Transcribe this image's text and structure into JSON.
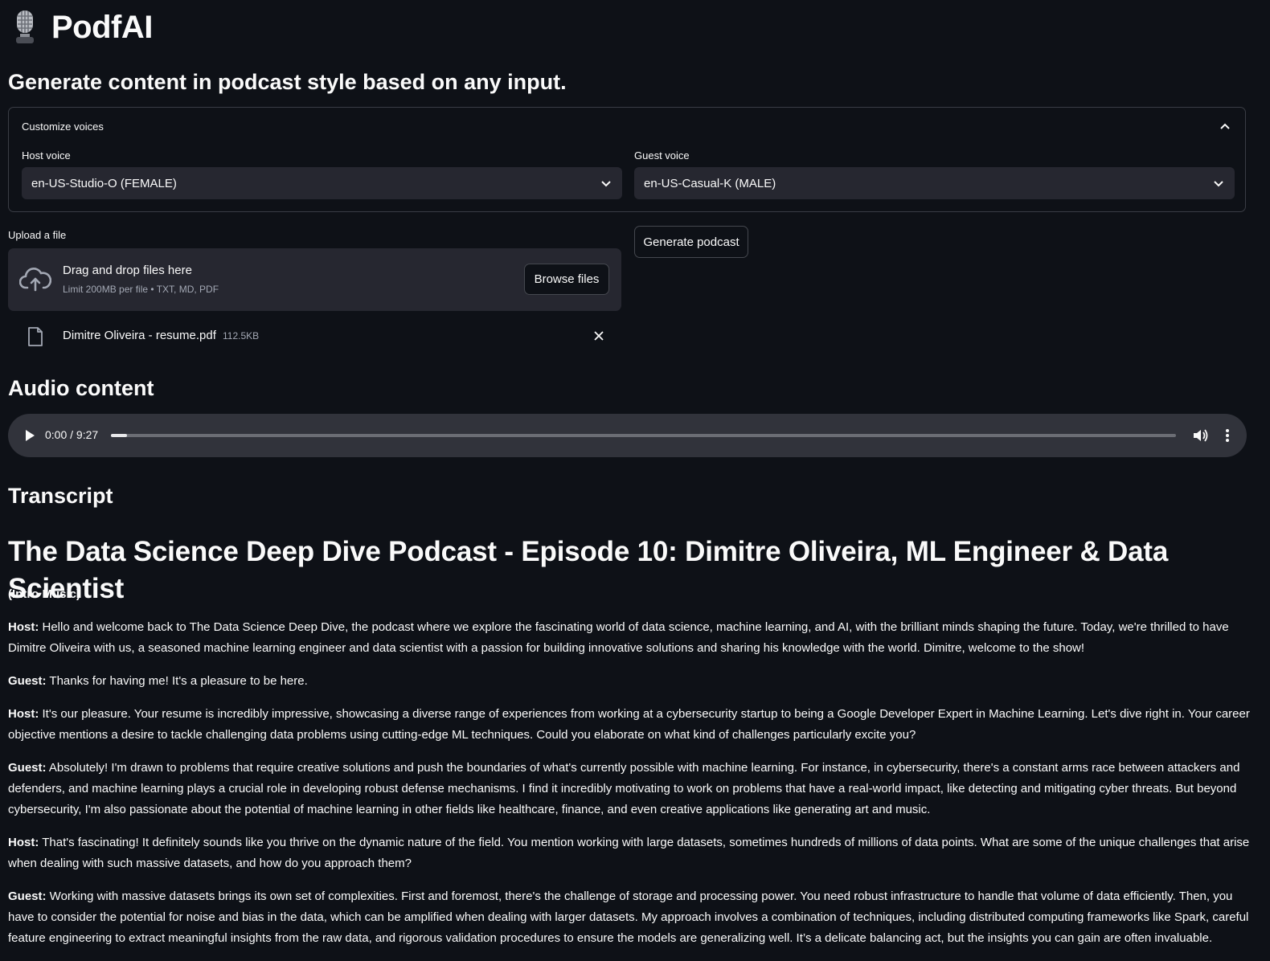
{
  "app": {
    "title": "PodfAI",
    "subtitle": "Generate content in podcast style based on any input."
  },
  "voices": {
    "expander_label": "Customize voices",
    "host_label": "Host voice",
    "host_value": "en-US-Studio-O (FEMALE)",
    "guest_label": "Guest voice",
    "guest_value": "en-US-Casual-K (MALE)"
  },
  "upload": {
    "label": "Upload a file",
    "drop_title": "Drag and drop files here",
    "drop_limit": "Limit 200MB per file • TXT, MD, PDF",
    "browse_label": "Browse files",
    "file_name": "Dimitre Oliveira - resume.pdf",
    "file_size": "112.5KB"
  },
  "generate_label": "Generate podcast",
  "audio": {
    "heading": "Audio content",
    "time": "0:00 / 9:27",
    "progress": 0.0
  },
  "transcript": {
    "heading": "Transcript",
    "episode_title": "The Data Science Deep Dive Podcast - Episode 10: Dimitre Oliveira, ML Engineer & Data Scientist",
    "intro": "(Intro Music)",
    "lines": [
      {
        "speaker": "Host:",
        "text": " Hello and welcome back to The Data Science Deep Dive, the podcast where we explore the fascinating world of data science, machine learning, and AI, with the brilliant minds shaping the future. Today, we're thrilled to have Dimitre Oliveira with us, a seasoned machine learning engineer and data scientist with a passion for building innovative solutions and sharing his knowledge with the world. Dimitre, welcome to the show!"
      },
      {
        "speaker": "Guest:",
        "text": " Thanks for having me! It's a pleasure to be here."
      },
      {
        "speaker": "Host:",
        "text": " It's our pleasure. Your resume is incredibly impressive, showcasing a diverse range of experiences from working at a cybersecurity startup to being a Google Developer Expert in Machine Learning. Let's dive right in. Your career objective mentions a desire to tackle challenging data problems using cutting-edge ML techniques. Could you elaborate on what kind of challenges particularly excite you?"
      },
      {
        "speaker": "Guest:",
        "text": " Absolutely! I'm drawn to problems that require creative solutions and push the boundaries of what's currently possible with machine learning. For instance, in cybersecurity, there's a constant arms race between attackers and defenders, and machine learning plays a crucial role in developing robust defense mechanisms. I find it incredibly motivating to work on problems that have a real-world impact, like detecting and mitigating cyber threats. But beyond cybersecurity, I'm also passionate about the potential of machine learning in other fields like healthcare, finance, and even creative applications like generating art and music."
      },
      {
        "speaker": "Host:",
        "text": " That's fascinating! It definitely sounds like you thrive on the dynamic nature of the field. You mention working with large datasets, sometimes hundreds of millions of data points. What are some of the unique challenges that arise when dealing with such massive datasets, and how do you approach them?"
      },
      {
        "speaker": "Guest:",
        "text": " Working with massive datasets brings its own set of complexities. First and foremost, there's the challenge of storage and processing power. You need robust infrastructure to handle that volume of data efficiently. Then, you have to consider the potential for noise and bias in the data, which can be amplified when dealing with larger datasets. My approach involves a combination of techniques, including distributed computing frameworks like Spark, careful feature engineering to extract meaningful insights from the raw data, and rigorous validation procedures to ensure the models are generalizing well. It’s a delicate balancing act, but the insights you can gain are often invaluable."
      }
    ]
  },
  "icons": [
    "microphone-icon",
    "chevron-up-icon",
    "chevron-down-icon",
    "cloud-upload-icon",
    "file-icon",
    "close-icon",
    "play-icon",
    "volume-icon",
    "more-vertical-icon"
  ]
}
